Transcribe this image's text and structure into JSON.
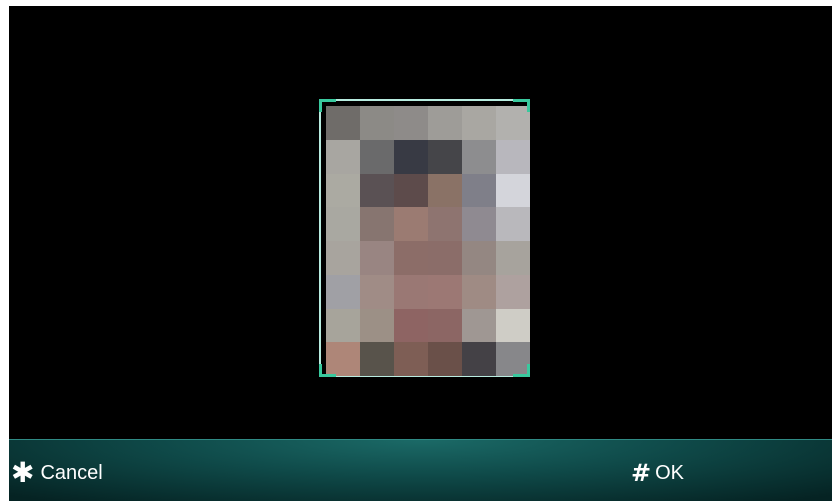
{
  "softkeys": {
    "left": {
      "icon": "asterisk-icon",
      "glyph": "✱",
      "label": "Cancel"
    },
    "right": {
      "icon": "hash-icon",
      "glyph": "#",
      "label": "OK"
    }
  },
  "preview": {
    "pixelated": true,
    "frame_color": "#b8ece0",
    "corner_color": "#39c99e",
    "mosaic_colors": [
      [
        "#6f6c69",
        "#8c8a86",
        "#8e8b89",
        "#9e9c98",
        "#a9a7a2",
        "#b2b1ae"
      ],
      [
        "#a8a6a1",
        "#6a6a6b",
        "#383a44",
        "#454549",
        "#8d8d8f",
        "#b8b7bd"
      ],
      [
        "#abaaa2",
        "#5a5154",
        "#5d4b4b",
        "#8a7266",
        "#7f7f89",
        "#d4d5db"
      ],
      [
        "#a9a8a1",
        "#877570",
        "#9b7b72",
        "#8e7470",
        "#8f8a91",
        "#b9b8bc"
      ],
      [
        "#a8a49e",
        "#998582",
        "#8c6d68",
        "#8b6d69",
        "#948782",
        "#a7a39d"
      ],
      [
        "#a0a0a5",
        "#a08c86",
        "#9a7874",
        "#9c7874",
        "#9f8b84",
        "#aea19f"
      ],
      [
        "#a7a49b",
        "#9c9086",
        "#8e6463",
        "#8c6664",
        "#9f9793",
        "#cfcdc6"
      ],
      [
        "#ae8678",
        "#58534b",
        "#7e5e55",
        "#6a5049",
        "#444146",
        "#87878a"
      ]
    ]
  }
}
